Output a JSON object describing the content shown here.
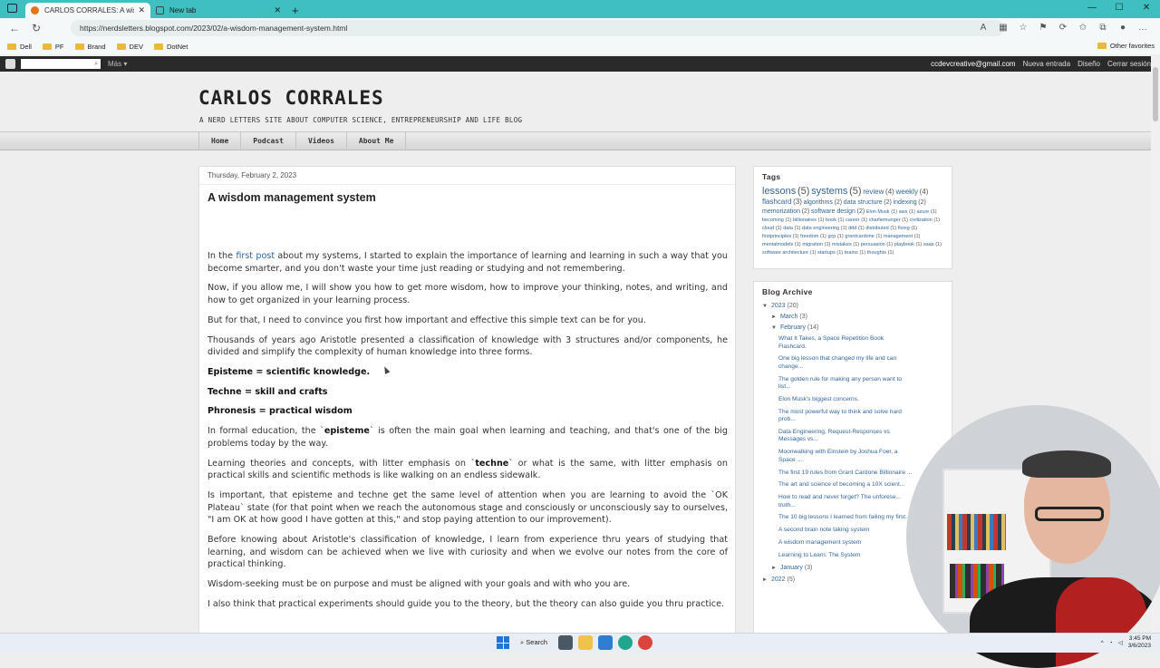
{
  "browser": {
    "tabs": [
      {
        "title": "CARLOS CORRALES: A wisdom m",
        "active": true
      },
      {
        "title": "New tab",
        "active": false
      }
    ],
    "url": "https://nerdsletters.blogspot.com/2023/02/a-wisdom-management-system.html",
    "bookmarks": [
      "Dell",
      "PF",
      "Brand",
      "DEV",
      "DotNet"
    ],
    "other_favorites": "Other favorites"
  },
  "blogger_nav": {
    "more": "Más ▾",
    "email": "ccdevcreative@gmail.com",
    "new_post": "Nueva entrada",
    "design": "Diseño",
    "sign_out": "Cerrar sesión"
  },
  "blog": {
    "title": "CARLOS CORRALES",
    "description": "A NERD LETTERS SITE ABOUT COMPUTER SCIENCE, ENTREPRENEURSHIP AND LIFE BLOG",
    "menu": [
      "Home",
      "Podcast",
      "Videos",
      "About Me"
    ]
  },
  "post": {
    "date": "Thursday, February 2, 2023",
    "title": "A wisdom management system",
    "p1_pre": "In the ",
    "p1_link": "first post",
    "p1_post": " about my systems, I started to explain the importance of learning and learning in such a way that you become smarter, and you don't waste your time just reading or studying and not remembering.",
    "p2": "Now, if you allow me, I will show you how to get more wisdom, how to improve your thinking, notes, and writing, and how to get organized in your learning process.",
    "p3": "But for that, I need to convince you first how important and effective this simple text can be for you.",
    "p4": "Thousands of years ago Aristotle presented a classification of knowledge with 3 structures and/or components, he divided and simplify the complexity of human knowledge into three forms.",
    "p5": "Episteme = scientific knowledge.",
    "p6": "Techne = skill and crafts",
    "p7": "Phronesis = practical wisdom",
    "p8_pre": "In formal education, the `",
    "p8_bold": "episteme",
    "p8_post": "` is often the main goal when learning and teaching, and that's one of the big problems today by the way.",
    "p9_pre": "Learning theories and concepts, with litter emphasis on `",
    "p9_bold": "techne",
    "p9_post": "` or what is the same, with litter emphasis on practical skills and scientific methods is like walking on an endless sidewalk.",
    "p10": "Is important, that episteme and techne get the same level of attention when you are learning to avoid the `OK Plateau` state (for that point when we reach the autonomous stage and consciously or unconsciously say to ourselves, \"I am OK at how good I have gotten at this,\" and stop paying attention to our improvement).",
    "p11": "Before knowing about Aristotle's classification of knowledge, I learn from experience thru years of studying that learning, and wisdom can be achieved when we live with curiosity and when we evolve our notes from the core of practical thinking.",
    "p12": "Wisdom-seeking must be on purpose and must be aligned with your goals and with who you are.",
    "p13": "I also think that practical experiments should guide you to the theory, but the theory can also guide you thru practice."
  },
  "tags": {
    "title": "Tags",
    "items": [
      {
        "name": "lessons",
        "count": "(5)",
        "size": 11
      },
      {
        "name": "systems",
        "count": "(5)",
        "size": 11
      },
      {
        "name": "review",
        "count": "(4)",
        "size": 8
      },
      {
        "name": "weekly",
        "count": "(4)",
        "size": 8
      },
      {
        "name": "flashcard",
        "count": "(3)",
        "size": 8
      },
      {
        "name": "algorithms",
        "count": "(2)",
        "size": 7
      },
      {
        "name": "data structure",
        "count": "(2)",
        "size": 7
      },
      {
        "name": "indexing",
        "count": "(2)",
        "size": 7
      },
      {
        "name": "memorization",
        "count": "(2)",
        "size": 7
      },
      {
        "name": "software design",
        "count": "(2)",
        "size": 7
      },
      {
        "name": "Elon Musk",
        "count": "(1)",
        "size": 5.5
      },
      {
        "name": "aws",
        "count": "(1)",
        "size": 5.5
      },
      {
        "name": "azure",
        "count": "(1)",
        "size": 5.5
      },
      {
        "name": "becoming",
        "count": "(1)",
        "size": 5.5
      },
      {
        "name": "billionaires",
        "count": "(1)",
        "size": 5.5
      },
      {
        "name": "book",
        "count": "(1)",
        "size": 5.5
      },
      {
        "name": "career",
        "count": "(1)",
        "size": 5.5
      },
      {
        "name": "charliemunger",
        "count": "(1)",
        "size": 5.5
      },
      {
        "name": "civilization",
        "count": "(1)",
        "size": 5.5
      },
      {
        "name": "cloud",
        "count": "(1)",
        "size": 5.5
      },
      {
        "name": "data",
        "count": "(1)",
        "size": 5.5
      },
      {
        "name": "data engineering",
        "count": "(1)",
        "size": 5.5
      },
      {
        "name": "ddd",
        "count": "(1)",
        "size": 5.5
      },
      {
        "name": "distributed",
        "count": "(1)",
        "size": 5.5
      },
      {
        "name": "fixing",
        "count": "(1)",
        "size": 5.5
      },
      {
        "name": "firstprinciples",
        "count": "(1)",
        "size": 5.5
      },
      {
        "name": "freedom",
        "count": "(1)",
        "size": 5.5
      },
      {
        "name": "gcp",
        "count": "(1)",
        "size": 5.5
      },
      {
        "name": "grantcardone",
        "count": "(1)",
        "size": 5.5
      },
      {
        "name": "management",
        "count": "(1)",
        "size": 5.5
      },
      {
        "name": "mentalmodels",
        "count": "(1)",
        "size": 5.5
      },
      {
        "name": "migration",
        "count": "(1)",
        "size": 5.5
      },
      {
        "name": "mistakes",
        "count": "(1)",
        "size": 5.5
      },
      {
        "name": "persuasion",
        "count": "(1)",
        "size": 5.5
      },
      {
        "name": "playbook",
        "count": "(1)",
        "size": 5.5
      },
      {
        "name": "saas",
        "count": "(1)",
        "size": 5.5
      },
      {
        "name": "software architecture",
        "count": "(1)",
        "size": 5.5
      },
      {
        "name": "startups",
        "count": "(1)",
        "size": 5.5
      },
      {
        "name": "teams",
        "count": "(1)",
        "size": 5.5
      },
      {
        "name": "thoughts",
        "count": "(1)",
        "size": 5.5
      }
    ]
  },
  "archive": {
    "title": "Blog Archive",
    "year_2023": "2023",
    "year_2023_count": "(20)",
    "march": "March",
    "march_count": "(3)",
    "february": "February",
    "february_count": "(14)",
    "posts": [
      "What It Takes, a Space Repetition Book Flashcard.",
      "One big lesson that changed my life and can change...",
      "The golden rule for making any person want to list...",
      "Elon Musk's biggest concerns.",
      "The most powerful way to think and solve hard prob...",
      "Data Engineering, Request-Responses vs Messages vs...",
      "Moonwalking with Einstein by Joshua Foer, a Space ...",
      "The first 19 rules from Grant Cardone Billionaire ...",
      "The art and science of becoming a 10X scient...",
      "How to read and never forget? The unforese... truth...",
      "The 10 big lessons I learned from failing my first...",
      "A second brain note taking system",
      "A wisdom management system",
      "Learning to Learn: The System"
    ],
    "january": "January",
    "january_count": "(3)",
    "year_2022": "2022",
    "year_2022_count": "(5)"
  },
  "taskbar": {
    "search": "Search",
    "time": "3:45 PM",
    "date": "3/6/2023"
  }
}
